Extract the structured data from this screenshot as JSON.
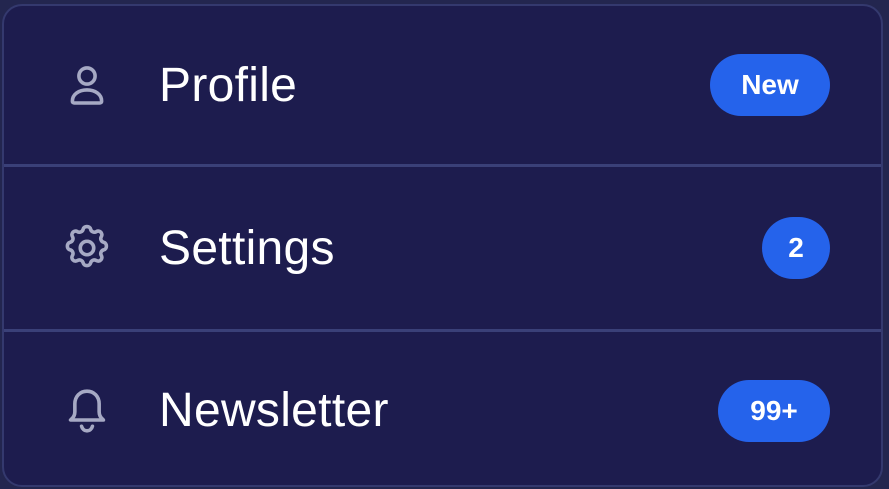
{
  "menu": {
    "items": [
      {
        "label": "Profile",
        "icon": "user-icon",
        "badge": "New"
      },
      {
        "label": "Settings",
        "icon": "gear-icon",
        "badge": "2"
      },
      {
        "label": "Newsletter",
        "icon": "bell-icon",
        "badge": "99+"
      }
    ]
  },
  "colors": {
    "background": "#1d1c4e",
    "border": "#34396e",
    "badge": "#2563eb",
    "icon": "#a6a9c4",
    "text": "#ffffff"
  }
}
